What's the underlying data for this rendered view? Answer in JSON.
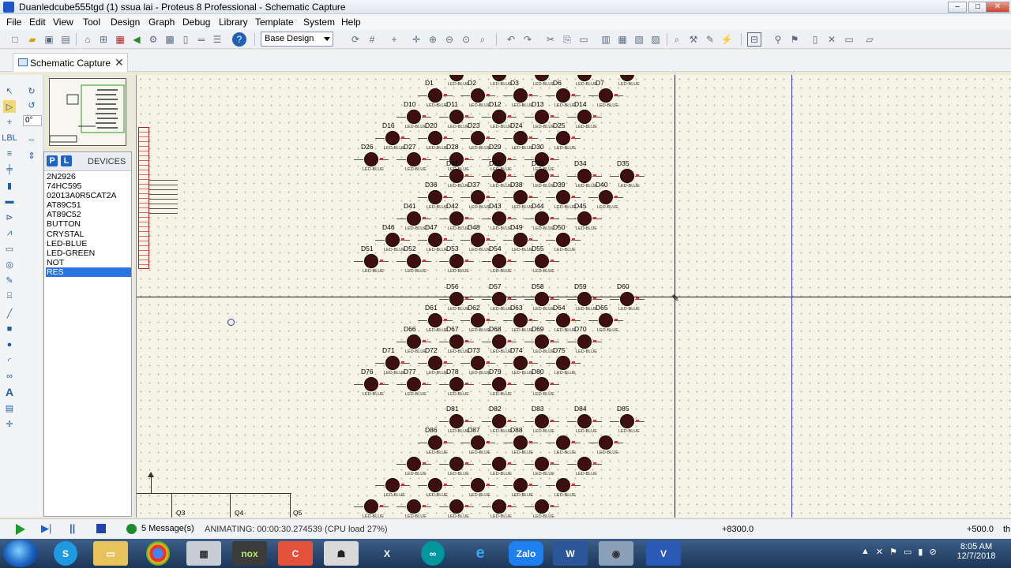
{
  "window": {
    "title": "Duanledcube555tgd (1) ssua lai - Proteus 8 Professional - Schematic Capture",
    "minimize": "–",
    "maximize": "□",
    "close": "✕"
  },
  "menu": {
    "items": [
      {
        "label": "File"
      },
      {
        "label": "Edit"
      },
      {
        "label": "View"
      },
      {
        "label": "Tool"
      },
      {
        "label": "Design"
      },
      {
        "label": "Graph"
      },
      {
        "label": "Debug"
      },
      {
        "label": "Library"
      },
      {
        "label": "Template"
      },
      {
        "label": "System"
      },
      {
        "label": "Help"
      }
    ]
  },
  "toolbar": {
    "layer_value": "Base Design"
  },
  "tab": {
    "label": "Schematic Capture",
    "close": "✕"
  },
  "left_tools": {
    "angle": "0°"
  },
  "devices": {
    "p_label": "P",
    "l_label": "L",
    "title": "DEVICES",
    "items": [
      "2N2926",
      "74HC595",
      "02013A0R5CAT2A",
      "AT89C51",
      "AT89C52",
      "BUTTON",
      "CRYSTAL",
      "LED-BLUE",
      "LED-GREEN",
      "NOT",
      "RES"
    ],
    "selected": "RES"
  },
  "schematic": {
    "led_sublabel": "LED-BLUE",
    "transistors": [
      "Q3",
      "Q4",
      "Q5"
    ],
    "led_labels": [
      "D1",
      "D2",
      "D3",
      "D6",
      "D7",
      "D10",
      "D11",
      "D12",
      "D13",
      "D14",
      "D16",
      "D20",
      "D23",
      "D24",
      "D25",
      "D26",
      "D27",
      "D28",
      "D29",
      "D30",
      "D31",
      "D32",
      "D33",
      "D34",
      "D35",
      "D36",
      "D37",
      "D38",
      "D39",
      "D40",
      "D41",
      "D42",
      "D43",
      "D44",
      "D45",
      "D46",
      "D47",
      "D48",
      "D49",
      "D50",
      "D51",
      "D52",
      "D53",
      "D54",
      "D55",
      "D56",
      "D57",
      "D58",
      "D59",
      "D60",
      "D61",
      "D62",
      "D63",
      "D64",
      "D65",
      "D66",
      "D67",
      "D68",
      "D69",
      "D70",
      "D71",
      "D72",
      "D73",
      "D74",
      "D75",
      "D76",
      "D77",
      "D78",
      "D79",
      "D80",
      "D81",
      "D82",
      "D83",
      "D84",
      "D85",
      "D86",
      "D87",
      "D88"
    ]
  },
  "status": {
    "messages": "5 Message(s)",
    "animating": "ANIMATING: 00:00:30.274539 (CPU load 27%)",
    "coord_x": "+8300.0",
    "coord_y": "+500.0",
    "unit": "th"
  },
  "taskbar": {
    "time": "8:05 AM",
    "date": "12/7/2018"
  },
  "colors": {
    "canvas_bg": "#f6f4e6",
    "led": "#3e0f0f",
    "accent": "#2a73e0",
    "crosshair_blue": "#3a3ad0"
  }
}
